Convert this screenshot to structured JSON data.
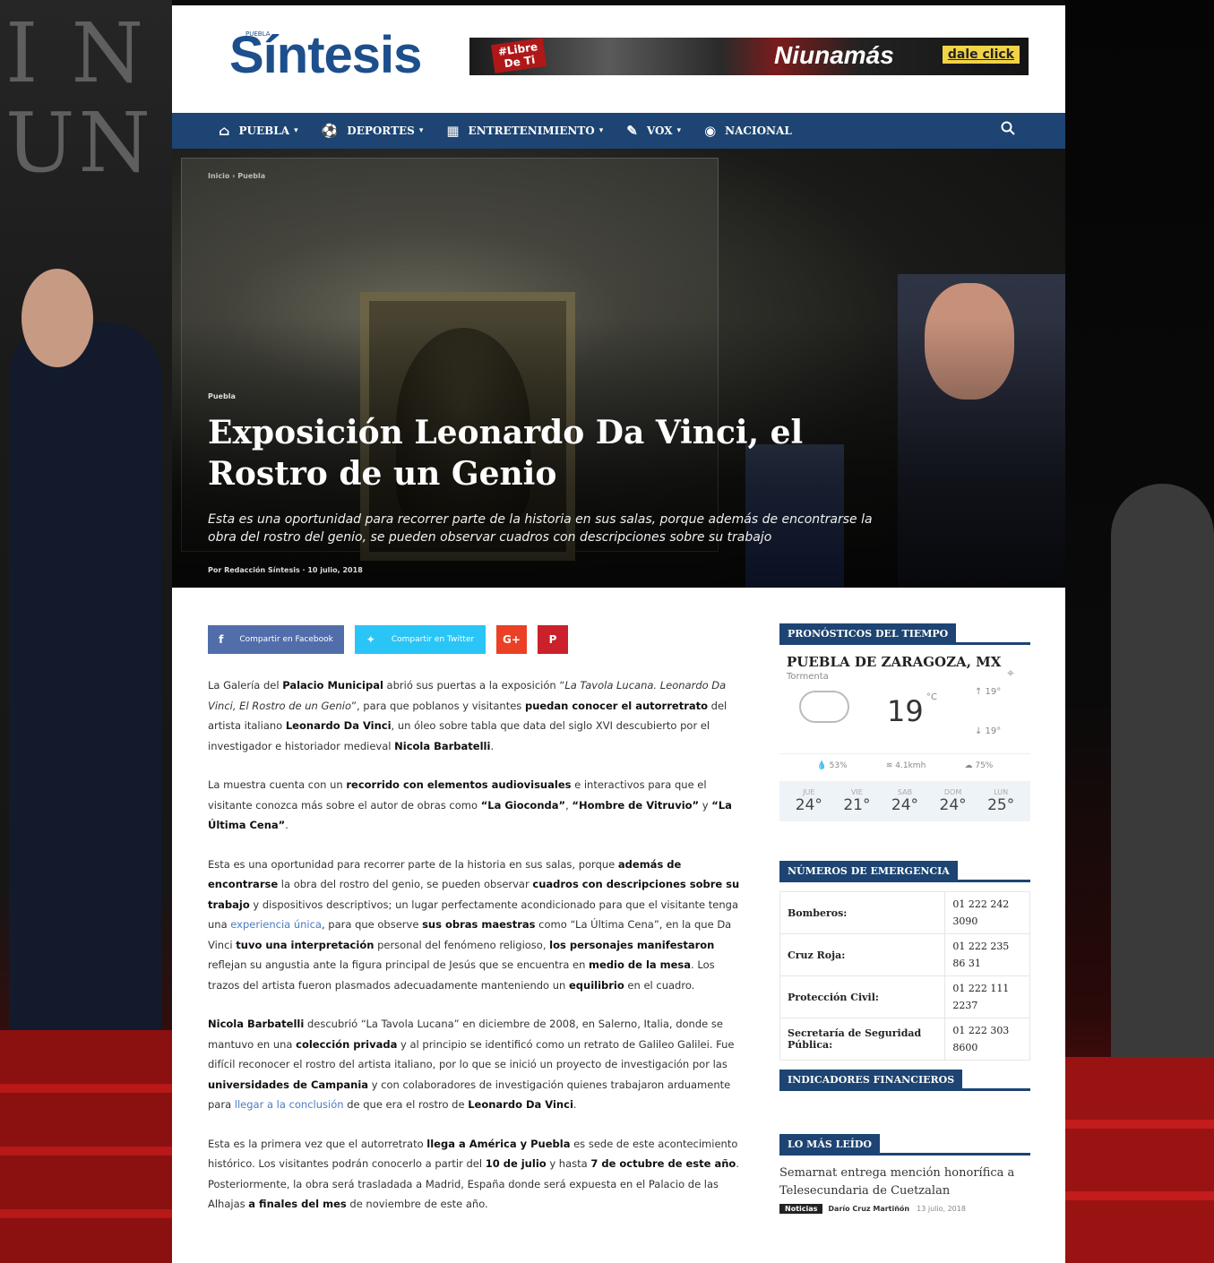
{
  "site": {
    "logo": "Síntesis",
    "logo_tag": "PUEBLA"
  },
  "banner": {
    "tag": "#Libre De Ti",
    "slogan": "Niunamás",
    "cta": "dale click"
  },
  "nav": {
    "items": [
      {
        "label": "PUEBLA",
        "icon": "home-icon",
        "glyph": "⌂",
        "dropdown": true
      },
      {
        "label": "DEPORTES",
        "icon": "soccer-ball-icon",
        "glyph": "⚽",
        "dropdown": true
      },
      {
        "label": "ENTRETENIMIENTO",
        "icon": "film-icon",
        "glyph": "▦",
        "dropdown": true
      },
      {
        "label": "VOX",
        "icon": "edit-icon",
        "glyph": "✎",
        "dropdown": true
      },
      {
        "label": "NACIONAL",
        "icon": "globe-icon",
        "glyph": "◉",
        "dropdown": false
      }
    ],
    "search_icon": "search-icon",
    "caret": "▾"
  },
  "hero": {
    "breadcrumb": "Inicio › Puebla",
    "category": "Puebla",
    "title": "Exposición Leonardo Da Vinci, el Rostro de un Genio",
    "subtitle": "Esta es una oportunidad para recorrer parte de la historia en sus salas, porque además de encontrarse la obra del rostro del genio, se pueden observar cuadros con descripciones sobre su trabajo",
    "meta": "Por Redacción Síntesis · 10 julio, 2018"
  },
  "share": {
    "facebook": "Compartir en Facebook",
    "twitter": "Compartir en Twitter",
    "google": "G+",
    "pinterest": "P"
  },
  "sidebar": {
    "weather_title": "PRONÓSTICOS DEL TIEMPO",
    "city": "PUEBLA DE ZARAGOZA, MX",
    "desc": "Tormenta",
    "temp": "19",
    "unit": "°C",
    "hi": "↑ 19°",
    "lo": "↓ 19°",
    "stats": [
      "💧 53%",
      "≋ 4.1kmh",
      "☁ 75%"
    ],
    "forecast": [
      {
        "day": "JUE",
        "temp": "24°"
      },
      {
        "day": "VIE",
        "temp": "21°"
      },
      {
        "day": "SAB",
        "temp": "24°"
      },
      {
        "day": "DOM",
        "temp": "24°"
      },
      {
        "day": "LUN",
        "temp": "25°"
      }
    ],
    "emergency_title": "NÚMEROS DE EMERGENCIA",
    "emergency": [
      {
        "name": "Bomberos:",
        "phone": "01 222 242 3090"
      },
      {
        "name": "Cruz Roja:",
        "phone": "01 222 235 86 31"
      },
      {
        "name": "Protección Civil:",
        "phone": "01 222 111 2237"
      },
      {
        "name": "Secretaría de Seguridad Pública:",
        "phone": "01 222 303 8600"
      }
    ],
    "finance_title": "INDICADORES FINANCIEROS",
    "most_read_title": "LO MÁS LEÍDO",
    "most_read": {
      "title": "Semarnat entrega mención honorífica a Telesecundaria de Cuetzalan",
      "badge": "Noticias",
      "author": "Darío Cruz Martiñón",
      "date": "13 julio, 2018"
    }
  },
  "colors": {
    "brand": "#1d4472",
    "logo": "#1d4f8c",
    "facebook": "#516eab",
    "twitter": "#29c5f6",
    "google": "#eb4026",
    "pinterest": "#ca212a"
  }
}
